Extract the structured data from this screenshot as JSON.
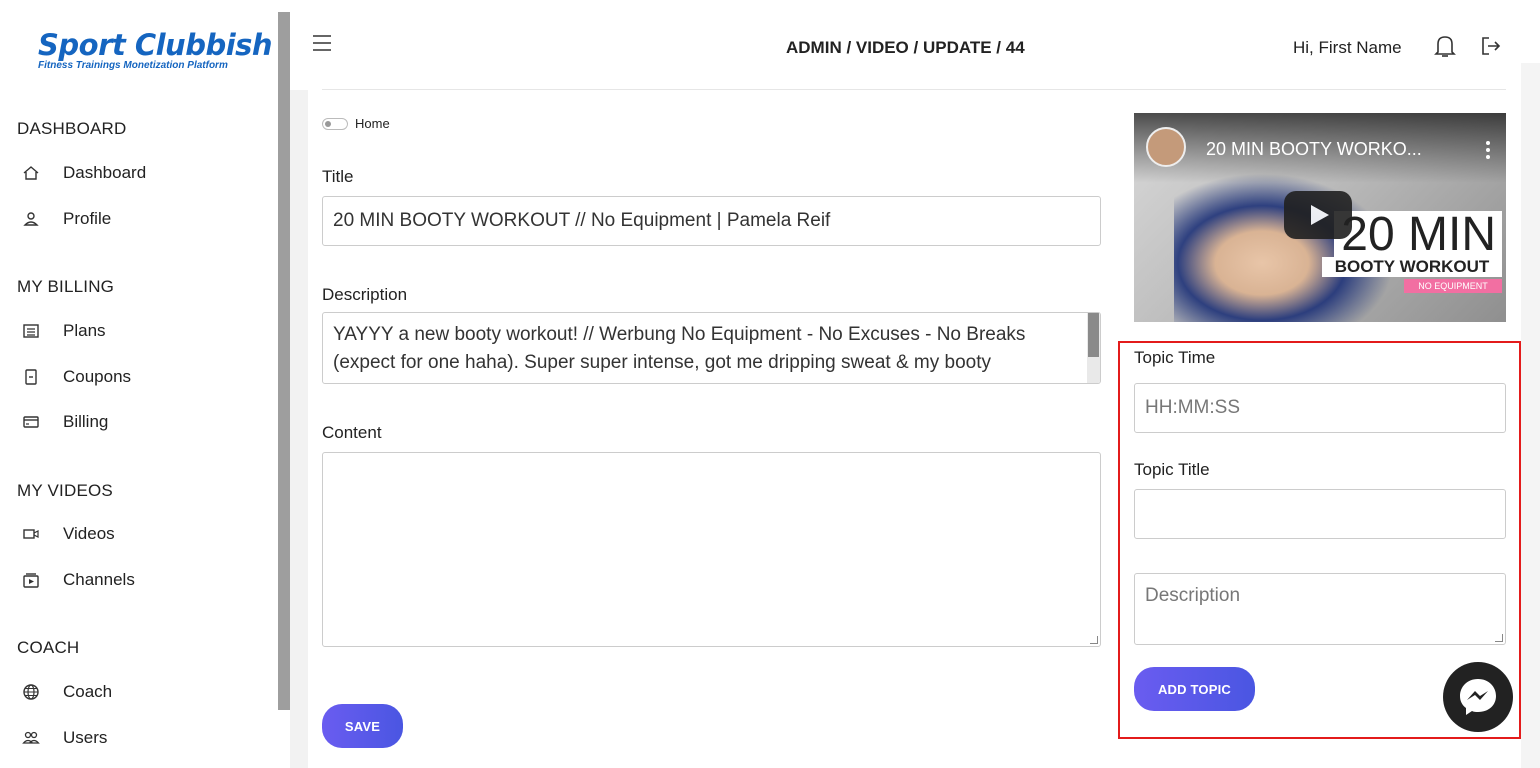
{
  "brand": {
    "name": "Sport Clubbish",
    "tagline": "Fitness Trainings Monetization Platform"
  },
  "sidebar": {
    "sections": [
      {
        "title": "DASHBOARD",
        "items": [
          {
            "label": "Dashboard",
            "icon": "home-icon"
          },
          {
            "label": "Profile",
            "icon": "user-icon"
          }
        ]
      },
      {
        "title": "MY BILLING",
        "items": [
          {
            "label": "Plans",
            "icon": "list-icon"
          },
          {
            "label": "Coupons",
            "icon": "coupon-icon"
          },
          {
            "label": "Billing",
            "icon": "card-icon"
          }
        ]
      },
      {
        "title": "MY VIDEOS",
        "items": [
          {
            "label": "Videos",
            "icon": "video-icon"
          },
          {
            "label": "Channels",
            "icon": "channel-icon"
          }
        ]
      },
      {
        "title": "COACH",
        "items": [
          {
            "label": "Coach",
            "icon": "globe-icon"
          },
          {
            "label": "Users",
            "icon": "users-icon"
          }
        ]
      }
    ]
  },
  "header": {
    "breadcrumb": "ADMIN / VIDEO / UPDATE / 44",
    "greeting": "Hi, First Name"
  },
  "form": {
    "toggle_label": "Home",
    "title_label": "Title",
    "title_value": "20 MIN BOOTY WORKOUT // No Equipment | Pamela Reif",
    "description_label": "Description",
    "description_value": "YAYYY a new booty workout! // Werbung No Equipment - No Excuses - No Breaks (expect for one haha). Super super intense, got me dripping sweat & my booty",
    "content_label": "Content",
    "content_value": "",
    "save_label": "SAVE"
  },
  "video": {
    "title": "20 MIN BOOTY WORKO...",
    "overlay_big": "20 MIN",
    "overlay_sub": "BOOTY WORKOUT",
    "overlay_tag": "NO EQUIPMENT"
  },
  "topic": {
    "time_label": "Topic Time",
    "time_placeholder": "HH:MM:SS",
    "title_label": "Topic Title",
    "title_value": "",
    "description_placeholder": "Description",
    "add_label": "ADD TOPIC"
  }
}
